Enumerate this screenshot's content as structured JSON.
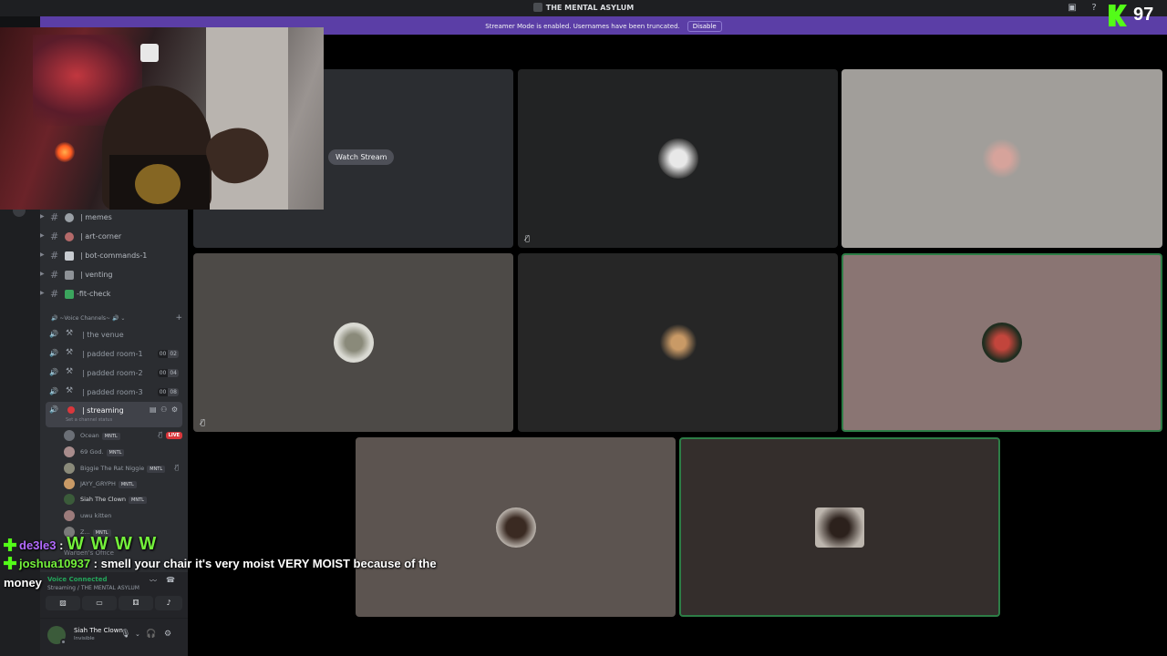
{
  "window": {
    "title": "THE MENTAL ASYLUM"
  },
  "banner": {
    "message": "Streamer Mode is enabled. Usernames have been truncated.",
    "disable_label": "Disable"
  },
  "kick": {
    "viewer_count": "97"
  },
  "channels": [
    {
      "name": "| memes"
    },
    {
      "name": "| art-corner"
    },
    {
      "name": "| bot-commands-1"
    },
    {
      "name": "| venting"
    },
    {
      "name": "-fit-check"
    }
  ],
  "voice_category": "~Voice Channels~",
  "voice_channels": [
    {
      "name": "| the venue"
    },
    {
      "name": "| padded room-1",
      "limit_a": "00",
      "limit_b": "02"
    },
    {
      "name": "| padded room-2",
      "limit_a": "00",
      "limit_b": "04"
    },
    {
      "name": "| padded room-3",
      "limit_a": "00",
      "limit_b": "08"
    },
    {
      "name": "| streaming",
      "status": "Set a channel status"
    }
  ],
  "voice_users": [
    {
      "name": "Ocean",
      "tag": "MNTL",
      "live": "LIVE"
    },
    {
      "name": "69 God.",
      "tag": "MNTL"
    },
    {
      "name": "Biggie The Rat Niggie",
      "tag": "MNTL"
    },
    {
      "name": "JAYY_GRYPH",
      "tag": "MNTL"
    },
    {
      "name": "Siah The Clown",
      "tag": "MNTL"
    },
    {
      "name": "uwu kitten"
    },
    {
      "name": "Z...",
      "tag": "MNTL"
    }
  ],
  "warden": "Warden's Office",
  "voice_panel": {
    "connected": "Voice Connected",
    "location": "Streaming / THE MENTAL ASYLUM"
  },
  "user_panel": {
    "name": "Siah The Clown",
    "status": "Invisible"
  },
  "stage": {
    "watch_label": "Watch Stream"
  },
  "chat": [
    {
      "user": "de3le3",
      "sep": ":",
      "text": "W W W W"
    },
    {
      "user": "joshua10937",
      "sep": ":",
      "text": "smell your chair it's very moist VERY MOIST because of the",
      "cont": "money"
    }
  ],
  "colors": {
    "accent": "#5b3ea6",
    "kick_green": "#53fc18",
    "speaking": "#2d7d46",
    "live": "#da373c"
  }
}
